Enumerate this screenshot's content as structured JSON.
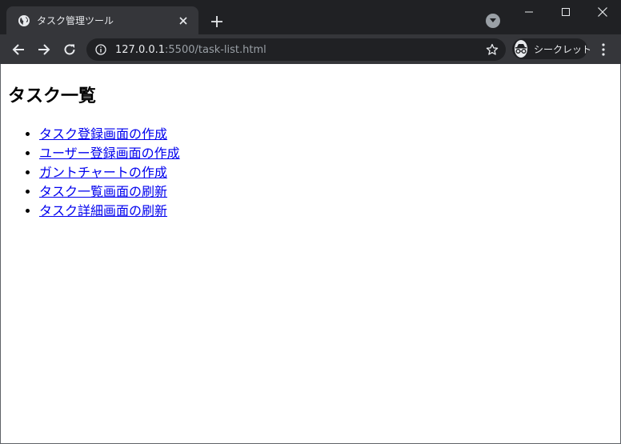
{
  "browser": {
    "tab_title": "タスク管理ツール",
    "url_host": "127.0.0.1",
    "url_rest": ":5500/task-list.html",
    "incognito_label": "シークレット"
  },
  "page": {
    "heading": "タスク一覧",
    "tasks": [
      {
        "label": "タスク登録画面の作成"
      },
      {
        "label": "ユーザー登録画面の作成"
      },
      {
        "label": "ガントチャートの作成"
      },
      {
        "label": "タスク一覧画面の刷新"
      },
      {
        "label": "タスク詳細画面の刷新"
      }
    ]
  },
  "colors": {
    "link": "#0000ee",
    "chrome_dark": "#202124",
    "chrome_tab": "#35363a"
  }
}
